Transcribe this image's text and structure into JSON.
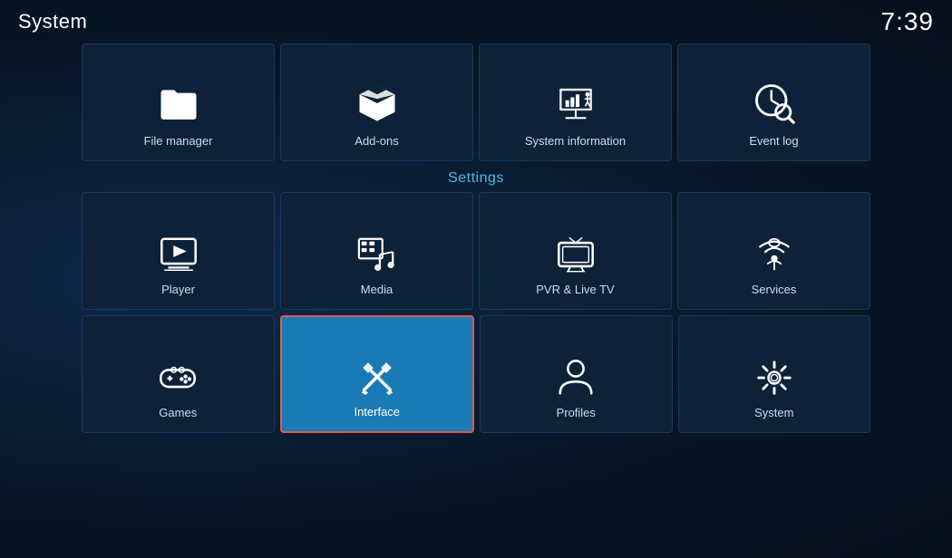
{
  "header": {
    "title": "System",
    "clock": "7:39"
  },
  "top_row": [
    {
      "id": "file-manager",
      "label": "File manager",
      "icon": "folder"
    },
    {
      "id": "add-ons",
      "label": "Add-ons",
      "icon": "box"
    },
    {
      "id": "system-information",
      "label": "System information",
      "icon": "projector"
    },
    {
      "id": "event-log",
      "label": "Event log",
      "icon": "clock-search"
    }
  ],
  "section_label": "Settings",
  "settings_row": [
    {
      "id": "player",
      "label": "Player",
      "icon": "play"
    },
    {
      "id": "media",
      "label": "Media",
      "icon": "media"
    },
    {
      "id": "pvr-live-tv",
      "label": "PVR & Live TV",
      "icon": "tv"
    },
    {
      "id": "services",
      "label": "Services",
      "icon": "wifi"
    }
  ],
  "bottom_row": [
    {
      "id": "games",
      "label": "Games",
      "icon": "gamepad"
    },
    {
      "id": "interface",
      "label": "Interface",
      "icon": "pencil",
      "active": true
    },
    {
      "id": "profiles",
      "label": "Profiles",
      "icon": "person"
    },
    {
      "id": "system",
      "label": "System",
      "icon": "gear"
    }
  ],
  "accent_color": "#4db8e8",
  "active_bg": "#1a7ab5",
  "active_border": "#e05a4a"
}
